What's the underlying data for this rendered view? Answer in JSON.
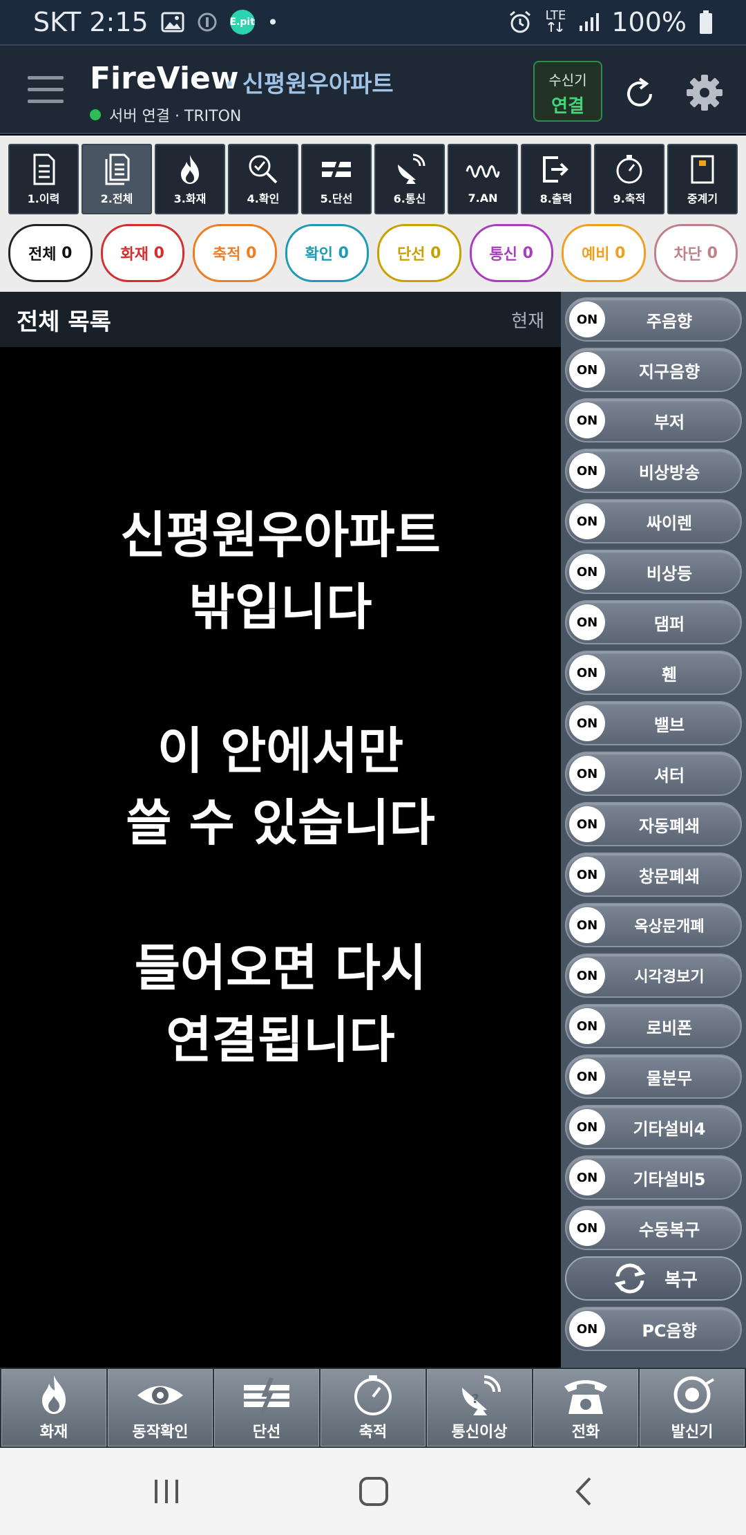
{
  "status_bar": {
    "carrier_time": "SKT 2:15",
    "epit_badge": "E.pit",
    "dot": "•",
    "network": "LTE",
    "battery": "100%"
  },
  "header": {
    "app_title": "FireView",
    "site_name": "· 신평원우아파트",
    "server_status": "서버 연결 · TRITON",
    "receiver_label": "수신기",
    "receiver_state": "연결"
  },
  "toolbar": [
    {
      "label": "1.이력",
      "icon": "document-icon"
    },
    {
      "label": "2.전체",
      "icon": "documents-icon"
    },
    {
      "label": "3.화재",
      "icon": "fire-icon"
    },
    {
      "label": "4.확인",
      "icon": "magnifier-check-icon"
    },
    {
      "label": "5.단선",
      "icon": "broken-line-icon"
    },
    {
      "label": "6.통신",
      "icon": "satellite-dish-icon"
    },
    {
      "label": "7.AN",
      "icon": "wave-icon"
    },
    {
      "label": "8.출력",
      "icon": "exit-icon"
    },
    {
      "label": "9.축적",
      "icon": "clock-icon"
    },
    {
      "label": "중계기",
      "icon": "relay-icon"
    }
  ],
  "chips": [
    {
      "label": "전체",
      "count": "0",
      "color": "#222222"
    },
    {
      "label": "화재",
      "count": "0",
      "color": "#d32f2f"
    },
    {
      "label": "축적",
      "count": "0",
      "color": "#ef7d22"
    },
    {
      "label": "확인",
      "count": "0",
      "color": "#1c9cb3"
    },
    {
      "label": "단선",
      "count": "0",
      "color": "#c9a000"
    },
    {
      "label": "통신",
      "count": "0",
      "color": "#a93dbd"
    },
    {
      "label": "예비",
      "count": "0",
      "color": "#f0a020"
    },
    {
      "label": "차단",
      "count": "0",
      "color": "#c0808a"
    }
  ],
  "list": {
    "title": "전체 목록",
    "current": "현재",
    "message": [
      "신평원우아파트",
      "밖입니다",
      "이 안에서만",
      "쓸 수 있습니다",
      "들어오면 다시",
      "연결됩니다"
    ]
  },
  "switches": [
    {
      "state": "ON",
      "label": "주음향"
    },
    {
      "state": "ON",
      "label": "지구음향"
    },
    {
      "state": "ON",
      "label": "부저"
    },
    {
      "state": "ON",
      "label": "비상방송"
    },
    {
      "state": "ON",
      "label": "싸이렌"
    },
    {
      "state": "ON",
      "label": "비상등"
    },
    {
      "state": "ON",
      "label": "댐퍼"
    },
    {
      "state": "ON",
      "label": "휀"
    },
    {
      "state": "ON",
      "label": "밸브"
    },
    {
      "state": "ON",
      "label": "셔터"
    },
    {
      "state": "ON",
      "label": "자동폐쇄"
    },
    {
      "state": "ON",
      "label": "창문폐쇄"
    },
    {
      "state": "ON",
      "label": "옥상문개폐"
    },
    {
      "state": "ON",
      "label": "시각경보기"
    },
    {
      "state": "ON",
      "label": "로비폰"
    },
    {
      "state": "ON",
      "label": "물분무"
    },
    {
      "state": "ON",
      "label": "기타설비4"
    },
    {
      "state": "ON",
      "label": "기타설비5"
    },
    {
      "state": "ON",
      "label": "수동복구"
    }
  ],
  "restore_label": "복구",
  "pc_switch": {
    "state": "ON",
    "label": "PC음향"
  },
  "bottom_nav": [
    {
      "label": "화재",
      "icon": "fire-icon"
    },
    {
      "label": "동작확인",
      "icon": "eye-icon"
    },
    {
      "label": "단선",
      "icon": "broken-line-icon"
    },
    {
      "label": "축적",
      "icon": "clock-icon"
    },
    {
      "label": "통신이상",
      "icon": "satellite-dish-icon"
    },
    {
      "label": "전화",
      "icon": "telephone-icon"
    },
    {
      "label": "발신기",
      "icon": "transmitter-icon"
    }
  ]
}
